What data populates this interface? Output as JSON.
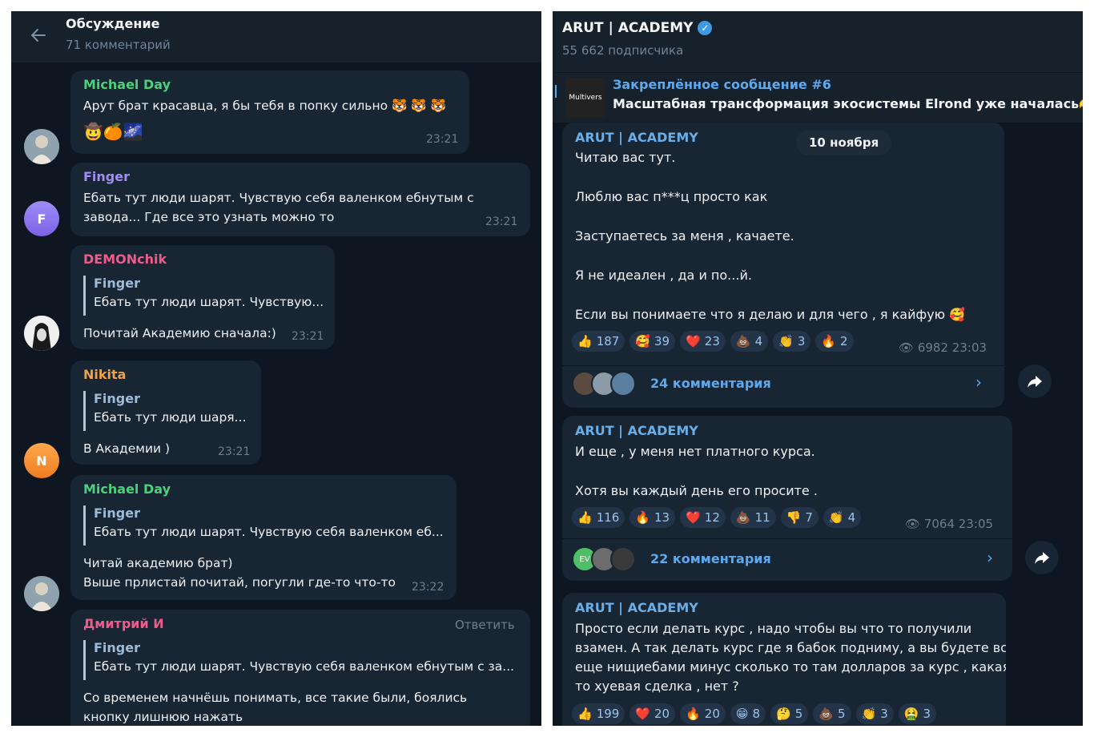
{
  "discussion": {
    "title": "Обсуждение",
    "subtitle": "71 комментарий",
    "reply_label": "Ответить",
    "comments": [
      {
        "author": "Michael Day",
        "author_color": "#4dd07c",
        "text": [
          "Арут брат красавца, я бы тебя в попку сильно 🐯 🐯 🐯",
          "🤠🍊🌌"
        ],
        "time": "23:21"
      },
      {
        "author": "Finger",
        "author_color": "#a48df2",
        "text": [
          "Ебать тут люди шарят. Чувствую себя валенком ебнутым с",
          "завода... Где все это узнать можно то"
        ],
        "time": "23:21",
        "avatar_letter": "F"
      },
      {
        "author": "DEMONchik",
        "author_color": "#ef5b8b",
        "quote_name": "Finger",
        "quote_text": "Ебать тут люди шарят. Чувствую...",
        "text": [
          "Почитай Академию сначала:)"
        ],
        "time": "23:21"
      },
      {
        "author": "Nikita",
        "author_color": "#f0a14a",
        "quote_name": "Finger",
        "quote_text": "Ебать тут люди шаря...",
        "text": [
          "В Академии )"
        ],
        "time": "23:21",
        "avatar_letter": "N"
      },
      {
        "author": "Michael Day",
        "author_color": "#4dd07c",
        "quote_name": "Finger",
        "quote_text": "Ебать тут люди шарят. Чувствую себя валенком еб...",
        "text": [
          "Читай академию брат)",
          "Выше прлистай почитай, погугли где-то что-то"
        ],
        "time": "23:22"
      },
      {
        "author": "Дмитрий И",
        "author_color": "#ef5b8b",
        "quote_name": "Finger",
        "quote_text": "Ебать тут люди шарят. Чувствую себя валенком ебнутым с за...",
        "text": [
          "Со временем начнёшь понимать, все такие были, боялись",
          "кнопку лишнюю нажать"
        ]
      }
    ]
  },
  "channel": {
    "title": "ARUT | ACADEMY",
    "subscribers": "55 662 подписчика",
    "pinned_title": "Закреплённое сообщение #6",
    "pinned_text": "Масштабная трансформация экосистемы Elrond уже началась🫶",
    "pinned_thumb": "Multivers",
    "date_pill": "10 ноября",
    "posts": [
      {
        "author": "ARUT | ACADEMY",
        "lines": [
          "Читаю вас тут.",
          "",
          "Люблю вас п***ц просто как",
          "",
          "Заступаетесь за меня , качаете.",
          "",
          "Я не идеален , да и по...й.",
          "",
          "Если вы понимаете что я делаю и для чего , я кайфую 🥰"
        ],
        "reactions": [
          {
            "emoji": "👍",
            "count": "187"
          },
          {
            "emoji": "🥰",
            "count": "39"
          },
          {
            "emoji": "❤️",
            "count": "23"
          },
          {
            "emoji": "💩",
            "count": "4"
          },
          {
            "emoji": "👏",
            "count": "3"
          },
          {
            "emoji": "🔥",
            "count": "2"
          }
        ],
        "views": "6982",
        "time": "23:03",
        "comments": "24 комментария"
      },
      {
        "author": "ARUT | ACADEMY",
        "lines": [
          "И еще , у меня нет платного курса.",
          "",
          "Хотя вы каждый день его просите ."
        ],
        "reactions": [
          {
            "emoji": "👍",
            "count": "116"
          },
          {
            "emoji": "🔥",
            "count": "13"
          },
          {
            "emoji": "❤️",
            "count": "12"
          },
          {
            "emoji": "💩",
            "count": "11"
          },
          {
            "emoji": "👎",
            "count": "7"
          },
          {
            "emoji": "👏",
            "count": "4"
          }
        ],
        "views": "7064",
        "time": "23:05",
        "comments": "22 комментария",
        "comment_avatar_text": "EV"
      },
      {
        "author": "ARUT | ACADEMY",
        "lines": [
          "Просто если делать курс  , надо чтобы вы что то получили",
          "взамен. А так делать курс где я бабок подниму, а вы будете все",
          "еще нищиебами минус сколько то там долларов за курс , какая",
          "то хуевая сделка , нет ?"
        ],
        "reactions": [
          {
            "emoji": "👍",
            "count": "199"
          },
          {
            "emoji": "❤️",
            "count": "20"
          },
          {
            "emoji": "🔥",
            "count": "20"
          },
          {
            "emoji": "😁",
            "count": "8"
          },
          {
            "emoji": "🤔",
            "count": "5"
          },
          {
            "emoji": "💩",
            "count": "5"
          },
          {
            "emoji": "👏",
            "count": "3"
          },
          {
            "emoji": "🤮",
            "count": "3"
          }
        ]
      }
    ]
  },
  "colors": {
    "panel_bg": "#17212b",
    "chat_bg": "#0e1621",
    "bubble": "#182533",
    "accent": "#5ea9ee"
  }
}
